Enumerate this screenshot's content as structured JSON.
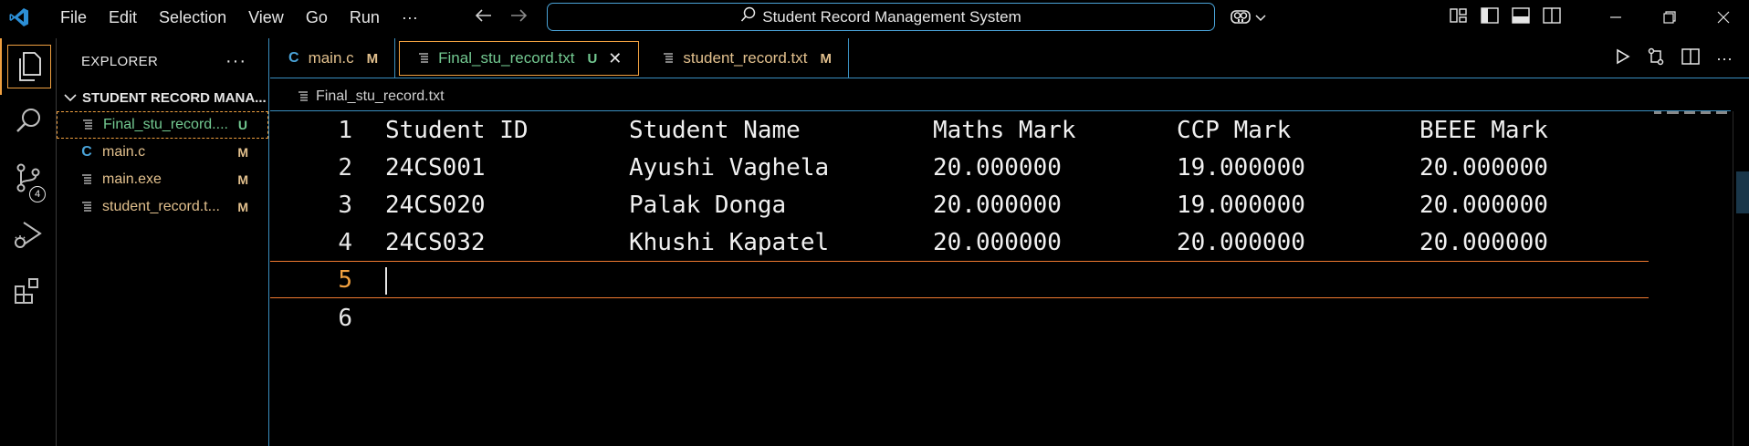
{
  "titlebar": {
    "menu": [
      "File",
      "Edit",
      "Selection",
      "View",
      "Go",
      "Run",
      "···"
    ],
    "search_text": "Student Record Management System"
  },
  "explorer": {
    "header": "EXPLORER",
    "more": "···",
    "section_title": "STUDENT RECORD MANA...",
    "files": [
      {
        "name": "Final_stu_record....",
        "status": "U",
        "icon": "text-file-icon",
        "color": "#73c991"
      },
      {
        "name": "main.c",
        "status": "M",
        "icon": "c-file-icon",
        "color": "#e2c08d"
      },
      {
        "name": "main.exe",
        "status": "M",
        "icon": "text-file-icon",
        "color": "#e2c08d"
      },
      {
        "name": "student_record.t...",
        "status": "M",
        "icon": "text-file-icon",
        "color": "#e2c08d"
      }
    ],
    "source_control_badge": "4"
  },
  "tabs": [
    {
      "label": "main.c",
      "status": "M",
      "icon": "c-file-icon",
      "color": "#e2c08d"
    },
    {
      "label": "Final_stu_record.txt",
      "status": "U",
      "icon": "text-file-icon",
      "color": "#73c991",
      "close": "✕"
    },
    {
      "label": "student_record.txt",
      "status": "M",
      "icon": "text-file-icon",
      "color": "#e2c08d"
    }
  ],
  "breadcrumb": "Final_stu_record.txt",
  "editor": {
    "line_numbers": [
      "1",
      "2",
      "3",
      "4",
      "5",
      "6"
    ],
    "rows": [
      [
        "Student ID",
        "Student Name",
        "Maths Mark",
        "CCP Mark",
        "BEEE Mark"
      ],
      [
        "24CS001",
        "Ayushi Vaghela",
        "20.000000",
        "19.000000",
        "20.000000"
      ],
      [
        "24CS020",
        "Palak Donga",
        "20.000000",
        "19.000000",
        "20.000000"
      ],
      [
        "24CS032",
        "Khushi Kapatel",
        "20.000000",
        "20.000000",
        "20.000000"
      ]
    ]
  },
  "colors": {
    "accent": "#f0a040",
    "focus_border": "#3a8fc0",
    "untracked": "#73c991",
    "modified": "#e2c08d"
  }
}
